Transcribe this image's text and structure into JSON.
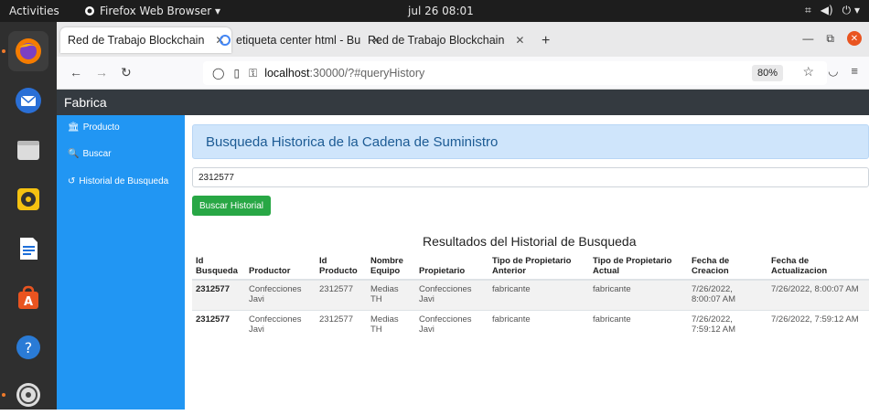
{
  "topbar": {
    "activities": "Activities",
    "app_name": "Firefox Web Browser ▾",
    "clock": "jul 26  08:01",
    "sys_icons": [
      "network-icon",
      "volume-icon",
      "power-icon"
    ]
  },
  "tabs": [
    {
      "label": "Red de Trabajo Blockchain",
      "active": true
    },
    {
      "label": "etiqueta center html - Bu",
      "active": false
    },
    {
      "label": "Red de Trabajo Blockchain",
      "active": false
    }
  ],
  "url": {
    "host": "localhost",
    "path": ":30000/?#queryHistory",
    "zoom": "80%"
  },
  "header": {
    "brand": "Fabrica"
  },
  "sidebar": {
    "items": [
      {
        "label": "Producto",
        "icon": "bank-icon"
      },
      {
        "label": "Buscar",
        "icon": "search-icon"
      },
      {
        "label": "Historial de Busqueda",
        "icon": "history-icon"
      }
    ]
  },
  "main": {
    "title": "Busqueda Historica de la Cadena de Suministro",
    "search_value": "2312577",
    "button_label": "Buscar Historial",
    "results_title": "Resultados del Historial de Busqueda",
    "columns": [
      "Id Busqueda",
      "Productor",
      "Id Producto",
      "Nombre Equipo",
      "Propietario",
      "Tipo de Propietario Anterior",
      "Tipo de Propietario Actual",
      "Fecha de Creacion",
      "Fecha de Actualizacion"
    ],
    "rows": [
      [
        "2312577",
        "Confecciones Javi",
        "2312577",
        "Medias TH",
        "Confecciones Javi",
        "fabricante",
        "fabricante",
        "7/26/2022, 8:00:07 AM",
        "7/26/2022, 8:00:07 AM"
      ],
      [
        "2312577",
        "Confecciones Javi",
        "2312577",
        "Medias TH",
        "Confecciones Javi",
        "fabricante",
        "fabricante",
        "7/26/2022, 7:59:12 AM",
        "7/26/2022, 7:59:12 AM"
      ]
    ]
  }
}
